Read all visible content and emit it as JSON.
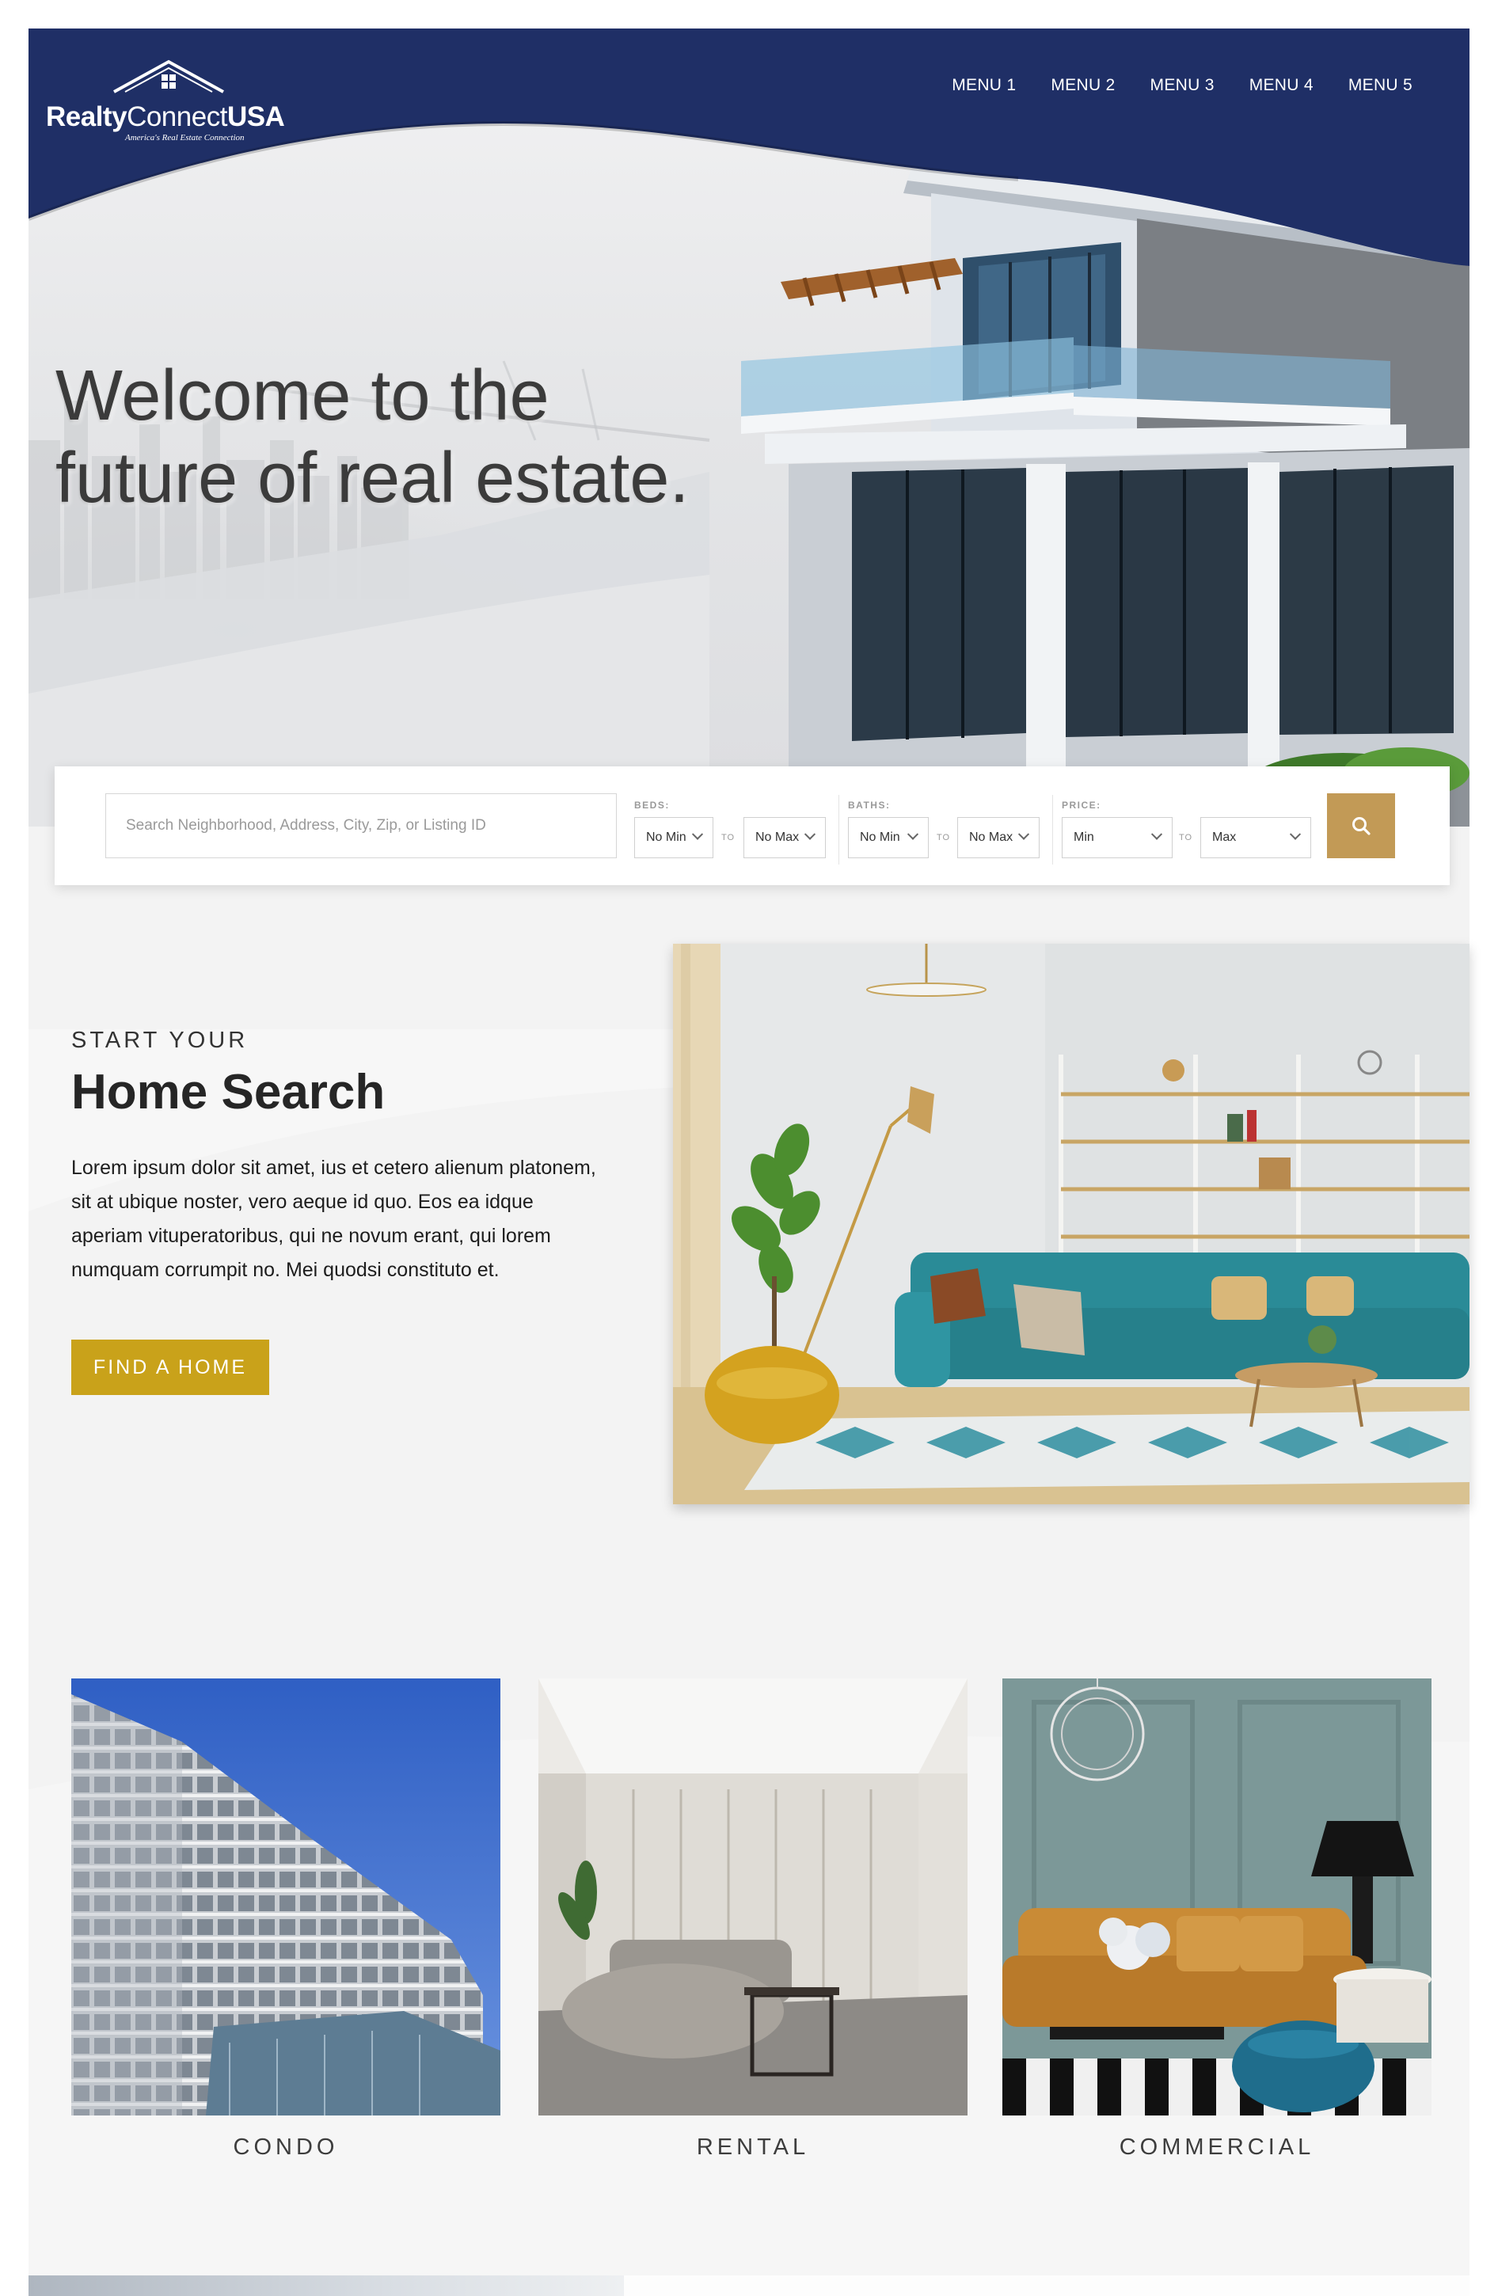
{
  "brand": {
    "name_part1": "Realty",
    "name_part2": "Connect",
    "name_part3": "USA",
    "tagline": "America's Real Estate Connection"
  },
  "nav": {
    "items": [
      "MENU 1",
      "MENU 2",
      "MENU 3",
      "MENU 4",
      "MENU 5"
    ]
  },
  "hero": {
    "title_line1": "Welcome to the",
    "title_line2": "future of real estate."
  },
  "search": {
    "placeholder": "Search Neighborhood, Address, City, Zip, or Listing ID",
    "beds": {
      "label": "BEDS:",
      "min": "No Min",
      "to": "TO",
      "max": "No Max"
    },
    "baths": {
      "label": "BATHS:",
      "min": "No Min",
      "to": "TO",
      "max": "No Max"
    },
    "price": {
      "label": "PRICE:",
      "min": "Min",
      "to": "TO",
      "max": "Max"
    },
    "button_icon": "search-icon"
  },
  "home_search": {
    "eyebrow": "START YOUR",
    "title": "Home Search",
    "body": "Lorem ipsum dolor sit amet, ius et cetero alienum platonem, sit at ubique noster, vero aeque id quo. Eos ea idque aperiam vituperatoribus, qui ne novum erant, qui lorem numquam corrumpit no. Mei quodsi constituto et.",
    "cta": "FIND A HOME"
  },
  "categories": [
    {
      "label": "CONDO"
    },
    {
      "label": "RENTAL"
    },
    {
      "label": "COMMERCIAL"
    }
  ],
  "colors": {
    "navy": "#1f2f66",
    "gold_button": "#c9a21a",
    "search_button": "#c29a56",
    "section_bg": "#f3f3f3"
  }
}
